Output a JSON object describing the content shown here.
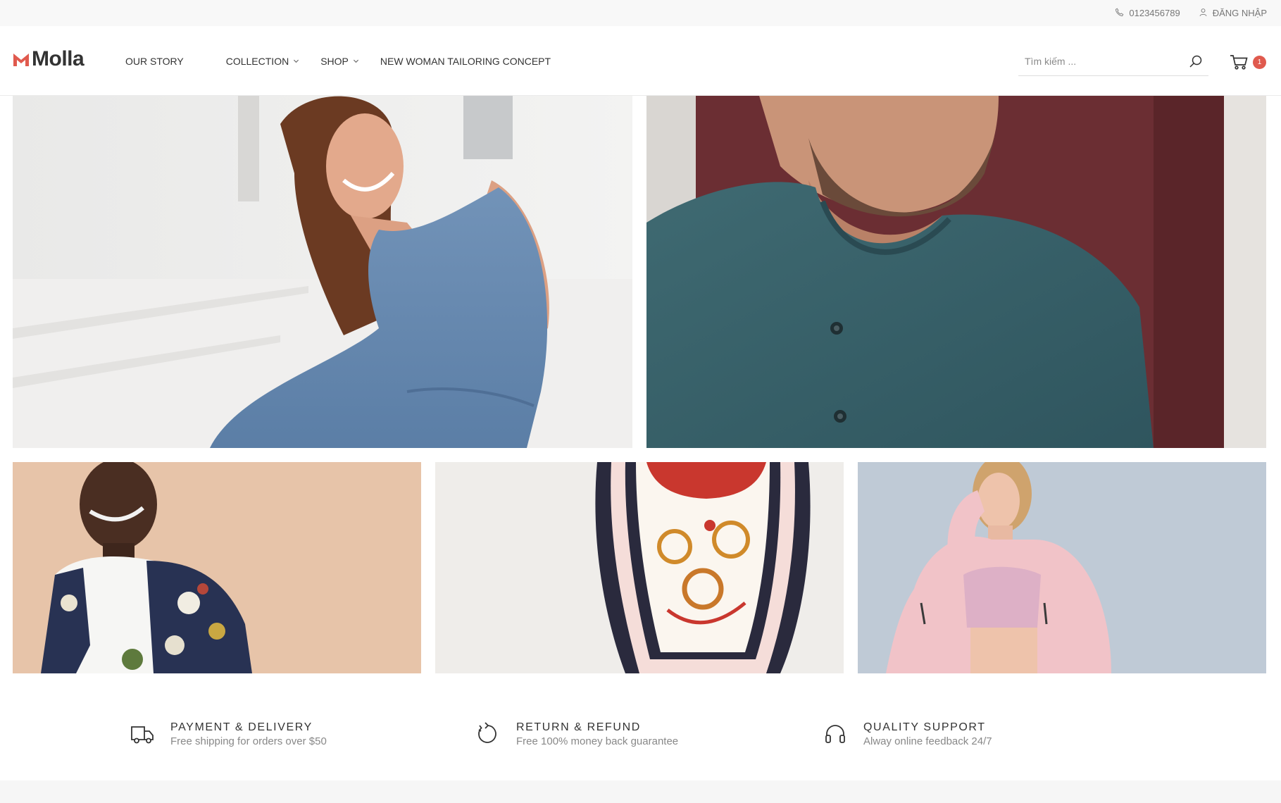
{
  "topbar": {
    "phone": "0123456789",
    "login": "ĐĂNG NHẬP",
    "phone_icon": "phone-icon",
    "user_icon": "user-icon"
  },
  "header": {
    "logo_text": "Molla",
    "nav": {
      "our_story": "OUR STORY",
      "collection": "COLLECTION",
      "shop": "SHOP",
      "tailoring": "NEW WOMAN TAILORING CONCEPT"
    },
    "search_placeholder": "Tìm kiếm ...",
    "cart_count": "1"
  },
  "features": [
    {
      "icon": "truck-icon",
      "title": "PAYMENT & DELIVERY",
      "desc": "Free shipping for orders over $50"
    },
    {
      "icon": "refund-icon",
      "title": "RETURN & REFUND",
      "desc": "Free 100% money back guarantee"
    },
    {
      "icon": "headphones-icon",
      "title": "QUALITY SUPPORT",
      "desc": "Alway online feedback 24/7"
    }
  ],
  "colors": {
    "accent": "#e05a4e",
    "text": "#333333",
    "muted": "#888888",
    "topbar_bg": "#f8f8f8"
  }
}
